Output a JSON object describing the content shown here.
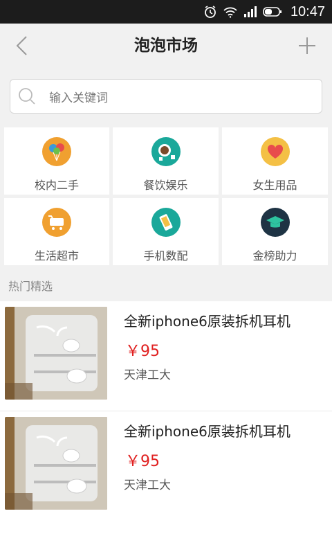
{
  "status_bar": {
    "time": "10:47"
  },
  "nav": {
    "title": "泡泡市场"
  },
  "search": {
    "placeholder": "输入关键词"
  },
  "categories": [
    {
      "label": "校内二手",
      "icon": "balloons-icon",
      "color": "#f0a030"
    },
    {
      "label": "餐饮娱乐",
      "icon": "coffee-cup-icon",
      "color": "#1aa89a"
    },
    {
      "label": "女生用品",
      "icon": "heart-icon",
      "color": "#f4c045"
    },
    {
      "label": "生活超市",
      "icon": "shopping-cart-icon",
      "color": "#f0a030"
    },
    {
      "label": "手机数配",
      "icon": "phone-icon",
      "color": "#1aa89a"
    },
    {
      "label": "金榜助力",
      "icon": "graduation-cap-icon",
      "color": "#1e3344"
    }
  ],
  "section": {
    "title": "热门精选"
  },
  "products": [
    {
      "title": "全新iphone6原装拆机耳机",
      "price": "￥95",
      "location": "天津工大"
    },
    {
      "title": "全新iphone6原装拆机耳机",
      "price": "￥95",
      "location": "天津工大"
    }
  ],
  "colors": {
    "price": "#e02020",
    "background": "#f1f1f1"
  }
}
